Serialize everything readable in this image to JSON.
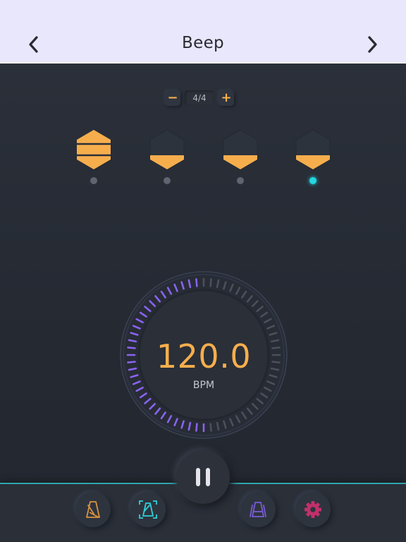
{
  "header": {
    "title": "Beep",
    "prev_icon": "chevron-left-icon",
    "next_icon": "chevron-right-icon"
  },
  "meter": {
    "value": "4/4",
    "minus_label": "−",
    "plus_label": "+"
  },
  "beats": [
    {
      "icon": "hexagon-accent-icon",
      "style": "accent",
      "active": false
    },
    {
      "icon": "hexagon-normal-icon",
      "style": "normal",
      "active": false
    },
    {
      "icon": "hexagon-normal-icon",
      "style": "normal",
      "active": false
    },
    {
      "icon": "hexagon-normal-icon",
      "style": "normal",
      "active": true
    }
  ],
  "tempo": {
    "value": "120.0",
    "unit": "BPM",
    "progress": 0.5
  },
  "transport": {
    "play_icon": "pause-icon"
  },
  "tabs": [
    {
      "icon": "metronome-icon",
      "color": "#d9923f"
    },
    {
      "icon": "tap-metronome-icon",
      "color": "#2fd1da"
    },
    {
      "icon": "multi-metronome-icon",
      "color": "#7a5cd6"
    },
    {
      "icon": "gear-icon",
      "color": "#c2306a"
    }
  ],
  "colors": {
    "accent": "#f6ae4d",
    "active_dot": "#24d6e0",
    "ring_active": "#8a63f0",
    "ring_inactive": "#4a505c",
    "header_bg": "#e9e7fb"
  }
}
